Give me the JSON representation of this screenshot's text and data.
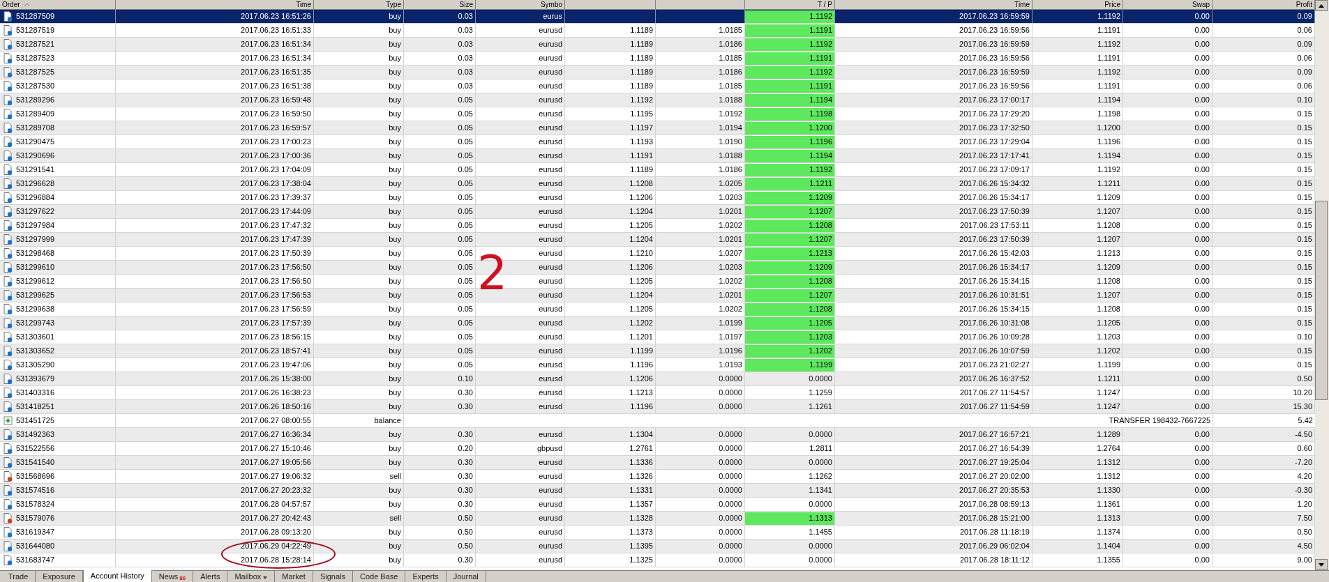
{
  "table": {
    "columns": [
      {
        "label": "Order",
        "sorted": true
      },
      {
        "label": "Time"
      },
      {
        "label": "Type"
      },
      {
        "label": "Size"
      },
      {
        "label": "Symbo"
      },
      {},
      {},
      {
        "label": "T / P"
      },
      {
        "label": "Time"
      },
      {
        "label": "Price"
      },
      {
        "label": "Swap"
      },
      {
        "label": "Profit"
      }
    ],
    "rows": [
      {
        "kind": "buy",
        "selected": true,
        "tp_hit": true,
        "cells": [
          "531287509",
          "2017.06.23 16:51:26",
          "buy",
          "0.03",
          "eurus",
          null,
          null,
          "1.1192",
          "2017.06.23 16:59:59",
          "1.1192",
          "0.00",
          "0.09"
        ]
      },
      {
        "kind": "buy",
        "selected": false,
        "tp_hit": true,
        "cells": [
          "531287519",
          "2017.06.23 16:51:33",
          "buy",
          "0.03",
          "eurusd",
          "1.1189",
          "1.0185",
          "1.1191",
          "2017.06.23 16:59:56",
          "1.1191",
          "0.00",
          "0.06"
        ]
      },
      {
        "kind": "buy",
        "selected": false,
        "tp_hit": true,
        "cells": [
          "531287521",
          "2017.06.23 16:51:34",
          "buy",
          "0.03",
          "eurusd",
          "1.1189",
          "1.0186",
          "1.1192",
          "2017.06.23 16:59:59",
          "1.1192",
          "0.00",
          "0.09"
        ]
      },
      {
        "kind": "buy",
        "selected": false,
        "tp_hit": true,
        "cells": [
          "531287523",
          "2017.06.23 16:51:34",
          "buy",
          "0.03",
          "eurusd",
          "1.1189",
          "1.0185",
          "1.1191",
          "2017.06.23 16:59:56",
          "1.1191",
          "0.00",
          "0.06"
        ]
      },
      {
        "kind": "buy",
        "selected": false,
        "tp_hit": true,
        "cells": [
          "531287525",
          "2017.06.23 16:51:35",
          "buy",
          "0.03",
          "eurusd",
          "1.1189",
          "1.0186",
          "1.1192",
          "2017.06.23 16:59:59",
          "1.1192",
          "0.00",
          "0.09"
        ]
      },
      {
        "kind": "buy",
        "selected": false,
        "tp_hit": true,
        "cells": [
          "531287530",
          "2017.06.23 16:51:38",
          "buy",
          "0.03",
          "eurusd",
          "1.1189",
          "1.0185",
          "1.1191",
          "2017.06.23 16:59:56",
          "1.1191",
          "0.00",
          "0.06"
        ]
      },
      {
        "kind": "buy",
        "selected": false,
        "tp_hit": true,
        "cells": [
          "531289296",
          "2017.06.23 16:59:48",
          "buy",
          "0.05",
          "eurusd",
          "1.1192",
          "1.0188",
          "1.1194",
          "2017.06.23 17:00:17",
          "1.1194",
          "0.00",
          "0.10"
        ]
      },
      {
        "kind": "buy",
        "selected": false,
        "tp_hit": true,
        "cells": [
          "531289409",
          "2017.06.23 16:59:50",
          "buy",
          "0.05",
          "eurusd",
          "1.1195",
          "1.0192",
          "1.1198",
          "2017.06.23 17:29:20",
          "1.1198",
          "0.00",
          "0.15"
        ]
      },
      {
        "kind": "buy",
        "selected": false,
        "tp_hit": true,
        "cells": [
          "531289708",
          "2017.06.23 16:59:57",
          "buy",
          "0.05",
          "eurusd",
          "1.1197",
          "1.0194",
          "1.1200",
          "2017.06.23 17:32:50",
          "1.1200",
          "0.00",
          "0.15"
        ]
      },
      {
        "kind": "buy",
        "selected": false,
        "tp_hit": true,
        "cells": [
          "531290475",
          "2017.06.23 17:00:23",
          "buy",
          "0.05",
          "eurusd",
          "1.1193",
          "1.0190",
          "1.1196",
          "2017.06.23 17:29:04",
          "1.1196",
          "0.00",
          "0.15"
        ]
      },
      {
        "kind": "buy",
        "selected": false,
        "tp_hit": true,
        "cells": [
          "531290696",
          "2017.06.23 17:00:36",
          "buy",
          "0.05",
          "eurusd",
          "1.1191",
          "1.0188",
          "1.1194",
          "2017.06.23 17:17:41",
          "1.1194",
          "0.00",
          "0.15"
        ]
      },
      {
        "kind": "buy",
        "selected": false,
        "tp_hit": true,
        "cells": [
          "531291541",
          "2017.06.23 17:04:09",
          "buy",
          "0.05",
          "eurusd",
          "1.1189",
          "1.0186",
          "1.1192",
          "2017.06.23 17:09:17",
          "1.1192",
          "0.00",
          "0.15"
        ]
      },
      {
        "kind": "buy",
        "selected": false,
        "tp_hit": true,
        "cells": [
          "531296628",
          "2017.06.23 17:38:04",
          "buy",
          "0.05",
          "eurusd",
          "1.1208",
          "1.0205",
          "1.1211",
          "2017.06.26 15:34:32",
          "1.1211",
          "0.00",
          "0.15"
        ]
      },
      {
        "kind": "buy",
        "selected": false,
        "tp_hit": true,
        "cells": [
          "531296884",
          "2017.06.23 17:39:37",
          "buy",
          "0.05",
          "eurusd",
          "1.1206",
          "1.0203",
          "1.1209",
          "2017.06.26 15:34:17",
          "1.1209",
          "0.00",
          "0.15"
        ]
      },
      {
        "kind": "buy",
        "selected": false,
        "tp_hit": true,
        "cells": [
          "531297622",
          "2017.06.23 17:44:09",
          "buy",
          "0.05",
          "eurusd",
          "1.1204",
          "1.0201",
          "1.1207",
          "2017.06.23 17:50:39",
          "1.1207",
          "0.00",
          "0.15"
        ]
      },
      {
        "kind": "buy",
        "selected": false,
        "tp_hit": true,
        "cells": [
          "531297984",
          "2017.06.23 17:47:32",
          "buy",
          "0.05",
          "eurusd",
          "1.1205",
          "1.0202",
          "1.1208",
          "2017.06.23 17:53:11",
          "1.1208",
          "0.00",
          "0.15"
        ]
      },
      {
        "kind": "buy",
        "selected": false,
        "tp_hit": true,
        "cells": [
          "531297999",
          "2017.06.23 17:47:39",
          "buy",
          "0.05",
          "eurusd",
          "1.1204",
          "1.0201",
          "1.1207",
          "2017.06.23 17:50:39",
          "1.1207",
          "0.00",
          "0.15"
        ]
      },
      {
        "kind": "buy",
        "selected": false,
        "tp_hit": true,
        "cells": [
          "531298468",
          "2017.06.23 17:50:39",
          "buy",
          "0.05",
          "eurusd",
          "1.1210",
          "1.0207",
          "1.1213",
          "2017.06.26 15:42:03",
          "1.1213",
          "0.00",
          "0.15"
        ]
      },
      {
        "kind": "buy",
        "selected": false,
        "tp_hit": true,
        "cells": [
          "531299610",
          "2017.06.23 17:56:50",
          "buy",
          "0.05",
          "eurusd",
          "1.1206",
          "1.0203",
          "1.1209",
          "2017.06.26 15:34:17",
          "1.1209",
          "0.00",
          "0.15"
        ]
      },
      {
        "kind": "buy",
        "selected": false,
        "tp_hit": true,
        "cells": [
          "531299612",
          "2017.06.23 17:56:50",
          "buy",
          "0.05",
          "eurusd",
          "1.1205",
          "1.0202",
          "1.1208",
          "2017.06.26 15:34:15",
          "1.1208",
          "0.00",
          "0.15"
        ]
      },
      {
        "kind": "buy",
        "selected": false,
        "tp_hit": true,
        "cells": [
          "531299625",
          "2017.06.23 17:56:53",
          "buy",
          "0.05",
          "eurusd",
          "1.1204",
          "1.0201",
          "1.1207",
          "2017.06.26 10:31:51",
          "1.1207",
          "0.00",
          "0.15"
        ]
      },
      {
        "kind": "buy",
        "selected": false,
        "tp_hit": true,
        "cells": [
          "531299638",
          "2017.06.23 17:56:59",
          "buy",
          "0.05",
          "eurusd",
          "1.1205",
          "1.0202",
          "1.1208",
          "2017.06.26 15:34:15",
          "1.1208",
          "0.00",
          "0.15"
        ]
      },
      {
        "kind": "buy",
        "selected": false,
        "tp_hit": true,
        "cells": [
          "531299743",
          "2017.06.23 17:57:39",
          "buy",
          "0.05",
          "eurusd",
          "1.1202",
          "1.0199",
          "1.1205",
          "2017.06.26 10:31:08",
          "1.1205",
          "0.00",
          "0.15"
        ]
      },
      {
        "kind": "buy",
        "selected": false,
        "tp_hit": true,
        "cells": [
          "531303601",
          "2017.06.23 18:56:15",
          "buy",
          "0.05",
          "eurusd",
          "1.1201",
          "1.0197",
          "1.1203",
          "2017.06.26 10:09:28",
          "1.1203",
          "0.00",
          "0.10"
        ]
      },
      {
        "kind": "buy",
        "selected": false,
        "tp_hit": true,
        "cells": [
          "531303652",
          "2017.06.23 18:57:41",
          "buy",
          "0.05",
          "eurusd",
          "1.1199",
          "1.0196",
          "1.1202",
          "2017.06.26 10:07:59",
          "1.1202",
          "0.00",
          "0.15"
        ]
      },
      {
        "kind": "buy",
        "selected": false,
        "tp_hit": true,
        "cells": [
          "531305290",
          "2017.06.23 19:47:06",
          "buy",
          "0.05",
          "eurusd",
          "1.1196",
          "1.0193",
          "1.1199",
          "2017.06.23 21:02:27",
          "1.1199",
          "0.00",
          "0.15"
        ]
      },
      {
        "kind": "buy",
        "selected": false,
        "tp_hit": false,
        "cells": [
          "531393679",
          "2017.06.26 15:38:00",
          "buy",
          "0.10",
          "eurusd",
          "1.1206",
          "0.0000",
          "0.0000",
          "2017.06.26 16:37:52",
          "1.1211",
          "0.00",
          "0.50"
        ]
      },
      {
        "kind": "buy",
        "selected": false,
        "tp_hit": false,
        "cells": [
          "531403316",
          "2017.06.26 16:38:23",
          "buy",
          "0.30",
          "eurusd",
          "1.1213",
          "0.0000",
          "1.1259",
          "2017.06.27 11:54:57",
          "1.1247",
          "0.00",
          "10.20"
        ]
      },
      {
        "kind": "buy",
        "selected": false,
        "tp_hit": false,
        "cells": [
          "531418251",
          "2017.06.26 18:50:16",
          "buy",
          "0.30",
          "eurusd",
          "1.1196",
          "0.0000",
          "1.1261",
          "2017.06.27 11:54:59",
          "1.1247",
          "0.00",
          "15.30"
        ]
      },
      {
        "kind": "balance",
        "selected": false,
        "order": "531451725",
        "time": "2017.06.27 08:00:55",
        "type": "balance",
        "comment": "TRANSFER 198432-7667225",
        "profit": "5.42"
      },
      {
        "kind": "buy",
        "selected": false,
        "tp_hit": false,
        "cells": [
          "531492363",
          "2017.06.27 16:36:34",
          "buy",
          "0.30",
          "eurusd",
          "1.1304",
          "0.0000",
          "0.0000",
          "2017.06.27 16:57:21",
          "1.1289",
          "0.00",
          "-4.50"
        ]
      },
      {
        "kind": "buy",
        "selected": false,
        "tp_hit": false,
        "cells": [
          "531522556",
          "2017.06.27 15:10:46",
          "buy",
          "0.20",
          "gbpusd",
          "1.2761",
          "0.0000",
          "1.2811",
          "2017.06.27 16:54:39",
          "1.2764",
          "0.00",
          "0.60"
        ]
      },
      {
        "kind": "buy",
        "selected": false,
        "tp_hit": false,
        "cells": [
          "531541540",
          "2017.06.27 19:05:56",
          "buy",
          "0.30",
          "eurusd",
          "1.1336",
          "0.0000",
          "0.0000",
          "2017.06.27 19:25:04",
          "1.1312",
          "0.00",
          "-7.20"
        ]
      },
      {
        "kind": "sell",
        "selected": false,
        "tp_hit": false,
        "cells": [
          "531568696",
          "2017.06.27 19:06:32",
          "sell",
          "0.30",
          "eurusd",
          "1.1326",
          "0.0000",
          "1.1262",
          "2017.06.27 20:02:00",
          "1.1312",
          "0.00",
          "4.20"
        ]
      },
      {
        "kind": "buy",
        "selected": false,
        "tp_hit": false,
        "cells": [
          "531574516",
          "2017.06.27 20:23:32",
          "buy",
          "0.30",
          "eurusd",
          "1.1331",
          "0.0000",
          "1.1341",
          "2017.06.27 20:35:53",
          "1.1330",
          "0.00",
          "-0.30"
        ]
      },
      {
        "kind": "buy",
        "selected": false,
        "tp_hit": false,
        "cells": [
          "531578324",
          "2017.06.28 04:57:57",
          "buy",
          "0.30",
          "eurusd",
          "1.1357",
          "0.0000",
          "0.0000",
          "2017.06.28 08:59:13",
          "1.1361",
          "0.00",
          "1.20"
        ]
      },
      {
        "kind": "sell",
        "selected": false,
        "tp_hit": true,
        "cells": [
          "531579076",
          "2017.06.27 20:42:43",
          "sell",
          "0.50",
          "eurusd",
          "1.1328",
          "0.0000",
          "1.1313",
          "2017.06.28 15:21:00",
          "1.1313",
          "0.00",
          "7.50"
        ]
      },
      {
        "kind": "buy",
        "selected": false,
        "tp_hit": false,
        "cells": [
          "531619347",
          "2017.06.28 09:13:20",
          "buy",
          "0.50",
          "eurusd",
          "1.1373",
          "0.0000",
          "1.1455",
          "2017.06.28 11:18:19",
          "1.1374",
          "0.00",
          "0.50"
        ]
      },
      {
        "kind": "buy",
        "selected": false,
        "tp_hit": false,
        "cells": [
          "531644080",
          "2017.06.29 04:22:49",
          "buy",
          "0.50",
          "eurusd",
          "1.1395",
          "0.0000",
          "0.0000",
          "2017.06.29 06:02:04",
          "1.1404",
          "0.00",
          "4.50"
        ]
      },
      {
        "kind": "buy",
        "selected": false,
        "tp_hit": false,
        "cells": [
          "531683747",
          "2017.06.28 15:28:14",
          "buy",
          "0.30",
          "eurusd",
          "1.1325",
          "0.0000",
          "0.0000",
          "2017.06.28 18:11:12",
          "1.1355",
          "0.00",
          "9.00"
        ]
      }
    ]
  },
  "annotations": {
    "number": "2"
  },
  "tabs": [
    {
      "label": "Trade",
      "selected": false
    },
    {
      "label": "Exposure",
      "selected": false
    },
    {
      "label": "Account History",
      "selected": true
    },
    {
      "label": "News",
      "badge": "86",
      "selected": false
    },
    {
      "label": "Alerts",
      "selected": false
    },
    {
      "label": "Mailbox",
      "selected": false
    },
    {
      "label": "Market",
      "selected": false
    },
    {
      "label": "Signals",
      "selected": false
    },
    {
      "label": "Code Base",
      "selected": false
    },
    {
      "label": "Experts",
      "selected": false
    },
    {
      "label": "Journal",
      "selected": false
    }
  ]
}
